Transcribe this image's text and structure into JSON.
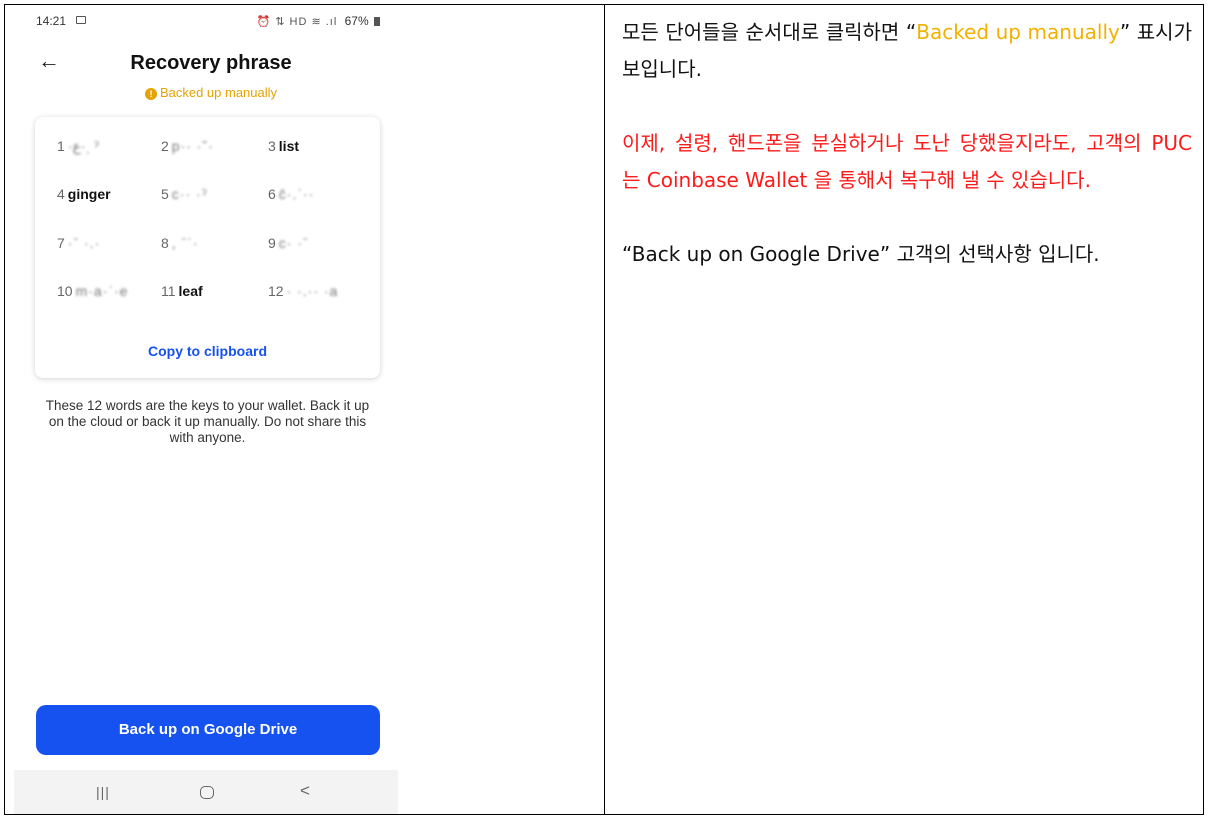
{
  "phone": {
    "status": {
      "time": "14:21",
      "icons": "⏰ ⇅ HD ≋ .ıl",
      "battery": "67%"
    },
    "header": {
      "back": "←",
      "title": "Recovery phrase",
      "subtitle": "Backed up manually"
    },
    "words": [
      {
        "n": "1",
        "text": "·ع·ˌ ˀ",
        "hidden": true
      },
      {
        "n": "2",
        "text": "p·· ·˘·",
        "hidden": true
      },
      {
        "n": "3",
        "text": "list",
        "hidden": false
      },
      {
        "n": "4",
        "text": "ginger",
        "hidden": false
      },
      {
        "n": "5",
        "text": "c·· ·ˀ",
        "hidden": true
      },
      {
        "n": "6",
        "text": "c̄·.ˈ··",
        "hidden": true
      },
      {
        "n": "7",
        "text": "·ˉ ·.·",
        "hidden": true
      },
      {
        "n": "8",
        "text": ", ˉˈ·",
        "hidden": true
      },
      {
        "n": "9",
        "text": "c· ·ˉ",
        "hidden": true
      },
      {
        "n": "10",
        "text": "m·a·ˈ·e",
        "hidden": true
      },
      {
        "n": "11",
        "text": "leaf",
        "hidden": false
      },
      {
        "n": "12",
        "text": "· ·.·· ·a",
        "hidden": true
      }
    ],
    "copy_label": "Copy to clipboard",
    "description": "These 12 words are the keys to your wallet. Back it up on the cloud or back it up manually. Do not share this with anyone.",
    "primary_button": "Back up on Google Drive",
    "nav": {
      "recent": "|||",
      "back": "<"
    }
  },
  "notes": {
    "p1_before": "모든 단어들을 순서대로 클릭하면 “",
    "p1_highlight": "Backed up manually",
    "p1_after": "” 표시가 보입니다.",
    "p2": "이제, 설령, 핸드폰을 분실하거나 도난 당했을지라도, 고객의 PUC 는 Coinbase Wallet 을 통해서 복구해 낼 수 있습니다.",
    "p3": "“Back up on Google Drive” 고객의 선택사항 입니다."
  },
  "colors": {
    "accent_blue": "#1652f0",
    "warning_orange": "#e6a300",
    "note_red": "#ff1a1a",
    "note_highlight": "#f2b100"
  }
}
